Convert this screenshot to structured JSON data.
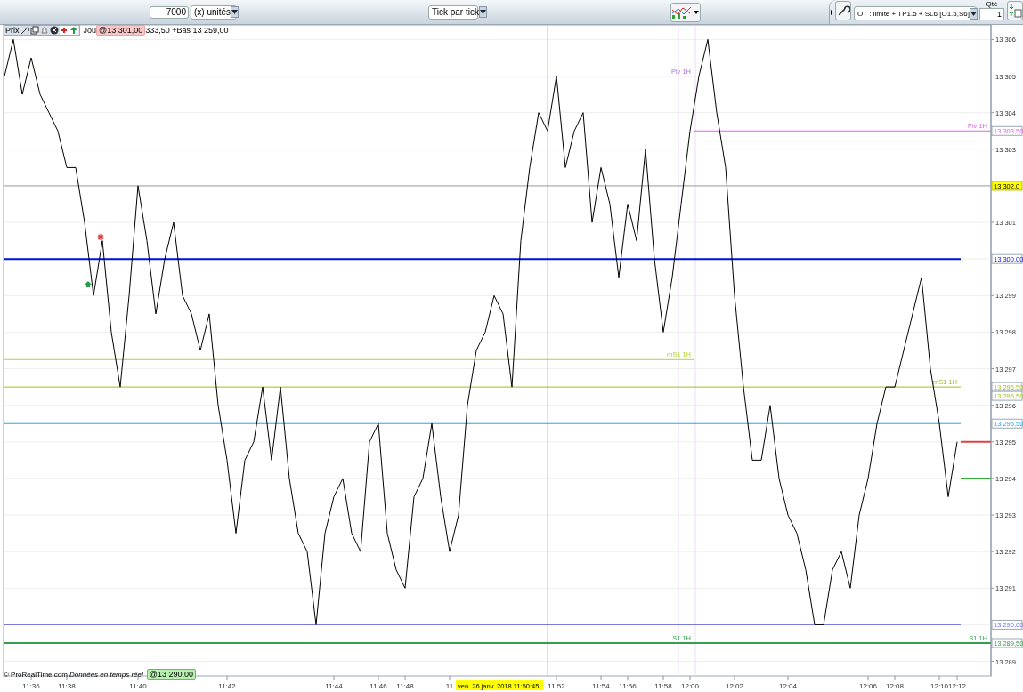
{
  "toolbar": {
    "units_field": {
      "value": "7000"
    },
    "units_select": {
      "value": "(x) unités"
    },
    "mode_select": {
      "value": "Tick par tick"
    },
    "order_select": {
      "value": "OT : limite + TP1.5 + SL6 [O1.5,S6]"
    },
    "qty_label": "Qté",
    "qty_field": {
      "value": "1"
    }
  },
  "chart": {
    "price_label": "Prix",
    "info_prefix": "Jou",
    "info_badge": "@13 301,00",
    "info_text": "333,50 +Bas 13 259,00",
    "cursor_label": "ven. 26 janv. 2018 11:50:45",
    "footer": "© ProRealTime.com *Données en temps réel*",
    "footer_badge": "@13 290,00",
    "levels": [
      {
        "kind": "left"
      },
      {
        "kind": "right",
        "tag": "13 303,50"
      },
      {
        "kind": "full",
        "tag": "13 302,0",
        "tag_highlight": true
      },
      {
        "kind": "main_bold",
        "tag": "13 300,00"
      },
      {
        "kind": "left"
      },
      {
        "kind": "main",
        "tag": "13 296,50",
        "tag_2": "13 296,50"
      },
      {
        "kind": "main",
        "tag": "13 295,50"
      },
      {
        "kind": "main",
        "tag": "13 290,00"
      },
      {
        "kind": "full_bold",
        "mid_label": "S1 1H",
        "tag": "13 289,50"
      }
    ],
    "chart_data": {
      "type": "line",
      "grid": true,
      "ylim": [
        13288.6,
        13306.4
      ],
      "categories": [
        null,
        null,
        null,
        "11:36",
        null,
        null,
        null,
        "11:38",
        null,
        null,
        null,
        null,
        null,
        null,
        null,
        "11:40",
        null,
        null,
        null,
        null,
        null,
        null,
        null,
        null,
        null,
        "11:42",
        null,
        null,
        null,
        null,
        null,
        null,
        null,
        null,
        null,
        null,
        null,
        "11:44",
        null,
        null,
        null,
        null,
        "11:46",
        null,
        null,
        "11:48",
        null,
        null,
        null,
        null,
        "11",
        null,
        null,
        null,
        null,
        null,
        null,
        null,
        null,
        null,
        null,
        null,
        "11:52",
        null,
        null,
        null,
        null,
        "11:54",
        null,
        null,
        "11:56",
        null,
        null,
        null,
        "11:58",
        null,
        null,
        "12:00",
        null,
        null,
        null,
        null,
        "12:02",
        null,
        null,
        null,
        null,
        null,
        "12:04",
        null,
        null,
        null,
        null,
        null,
        null,
        null,
        null,
        "12:06",
        null,
        null,
        "12:08",
        null,
        null,
        null,
        null,
        "12:10",
        null,
        "12:12"
      ],
      "yticks": [
        {
          "value": 13289,
          "label": "13 289"
        },
        {
          "value": 13291,
          "label": "13 291"
        },
        {
          "value": 13292,
          "label": "13 292"
        },
        {
          "value": 13293,
          "label": "13 293"
        },
        {
          "value": 13294,
          "label": "13 294"
        },
        {
          "value": 13295,
          "label": "13 295"
        },
        {
          "value": 13296,
          "label": "13 296"
        },
        {
          "value": 13297,
          "label": "13 297"
        },
        {
          "value": 13298,
          "label": "13 298"
        },
        {
          "value": 13299,
          "label": "13 299"
        },
        {
          "value": 13301,
          "label": "13 301"
        },
        {
          "value": 13303,
          "label": "13 303"
        },
        {
          "value": 13304,
          "label": "13 304"
        },
        {
          "value": 13305,
          "label": "13 305"
        },
        {
          "value": 13306,
          "label": "13 306"
        }
      ],
      "series": [
        {
          "color": "#000000",
          "values": [
            13305,
            13306,
            13304.5,
            13305.5,
            13304.5,
            13304,
            13303.5,
            13302.5,
            13302.5,
            13301,
            13299,
            13300.5,
            13298,
            13296.5,
            13299,
            13302,
            13300.5,
            13298.5,
            13300,
            13301,
            13299,
            13298.5,
            13297.5,
            13298.5,
            13296,
            13294.5,
            13292.5,
            13294.5,
            13295,
            13296.5,
            13294.5,
            13296.5,
            13294,
            13292.5,
            13292,
            13290,
            13292.5,
            13293.5,
            13294,
            13292.5,
            13292,
            13295,
            13295.5,
            13292.5,
            13291.5,
            13291,
            13293.5,
            13294,
            13295.5,
            13293.5,
            13292,
            13293,
            13296,
            13297.5,
            13298,
            13299,
            13298.5,
            13296.5,
            13300.5,
            13302.5,
            13304,
            13303.5,
            13305,
            13302.5,
            13303.5,
            13304,
            13301,
            13302.5,
            13301.5,
            13299.5,
            13301.5,
            13300.5,
            13303,
            13300,
            13298,
            13299.5,
            13301.5,
            13303.5,
            13305,
            13306,
            13304,
            13302.5,
            13299,
            13296.5,
            13294.5,
            13294.5,
            13296,
            13294,
            13293,
            13292.5,
            13291.5,
            13290,
            13290,
            13291.5,
            13292,
            13291,
            13293,
            13294,
            13295.5,
            13296.5,
            13296.5,
            13297.5,
            13298.5,
            13299.5,
            13297,
            13295.5,
            13293.5,
            13295
          ]
        }
      ],
      "ref_lines": [
        {
          "axis": "y",
          "value": 13305,
          "color": "#b070e0",
          "label": "Piv 1H"
        },
        {
          "axis": "y",
          "value": 13303.5,
          "color": "#e060f0",
          "label": "Piv 1H"
        },
        {
          "axis": "y",
          "value": 13302,
          "color": "#a0a0a0"
        },
        {
          "axis": "y",
          "value": 13300,
          "color": "#0010e0"
        },
        {
          "axis": "y",
          "value": 13297.25,
          "color": "#b0d040",
          "label": "mS1 1H"
        },
        {
          "axis": "y",
          "value": 13296.5,
          "color": "#a0c020",
          "label": "mS1 1H"
        },
        {
          "axis": "y",
          "value": 13295.5,
          "color": "#20a8f0"
        },
        {
          "axis": "y",
          "value": 13290,
          "color": "#7070e0"
        },
        {
          "axis": "y",
          "value": 13289.5,
          "color": "#30a050",
          "label": "S1 1H"
        }
      ]
    }
  }
}
